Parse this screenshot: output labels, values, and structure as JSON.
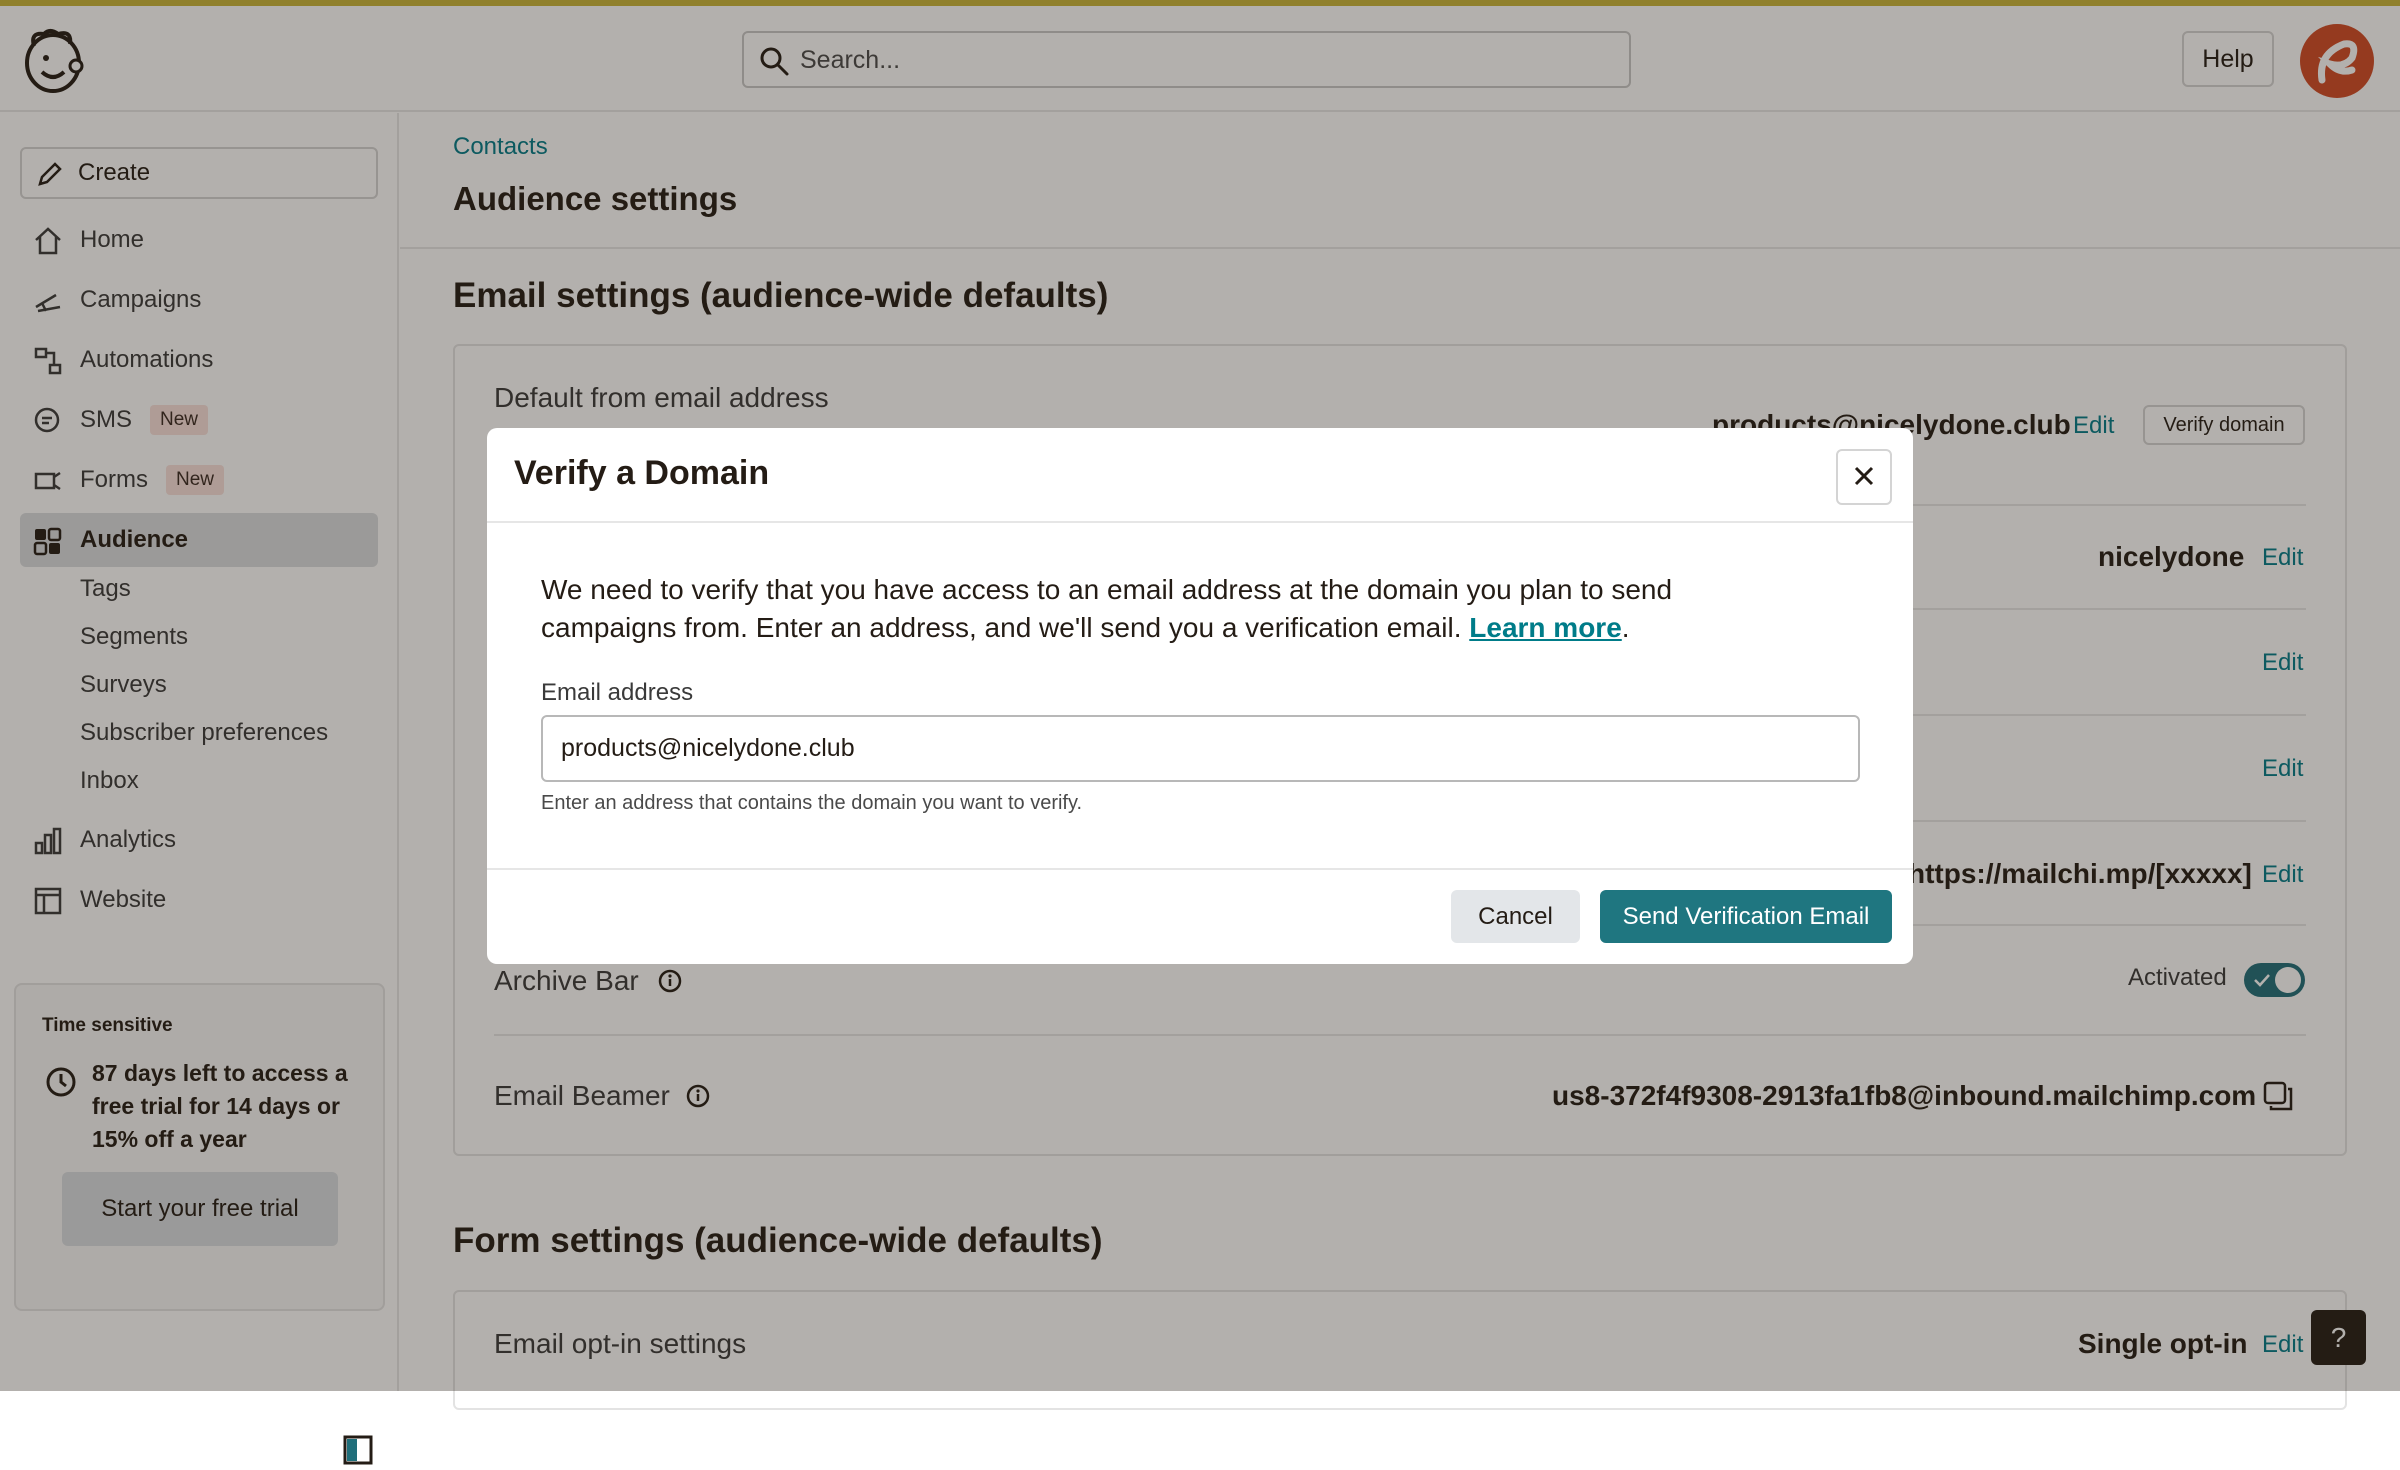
{
  "header": {
    "search_placeholder": "Search...",
    "help_label": "Help"
  },
  "sidebar": {
    "create_label": "Create",
    "items": [
      {
        "label": "Home",
        "icon": "home-icon"
      },
      {
        "label": "Campaigns",
        "icon": "megaphone-icon"
      },
      {
        "label": "Automations",
        "icon": "automations-icon"
      },
      {
        "label": "SMS",
        "icon": "sms-icon",
        "badge": "New"
      },
      {
        "label": "Forms",
        "icon": "forms-icon",
        "badge": "New"
      },
      {
        "label": "Audience",
        "icon": "audience-icon",
        "active": true
      },
      {
        "label": "Analytics",
        "icon": "bar-chart-icon"
      },
      {
        "label": "Website",
        "icon": "website-icon"
      }
    ],
    "sub_items": [
      "Tags",
      "Segments",
      "Surveys",
      "Subscriber preferences",
      "Inbox"
    ],
    "trial": {
      "tag": "Time sensitive",
      "text": "87 days left to access a free trial for 14 days or 15% off a year",
      "button": "Start your free trial"
    }
  },
  "main": {
    "breadcrumb": "Contacts",
    "title": "Audience settings",
    "email_section_title": "Email settings (audience-wide defaults)",
    "rows": {
      "from_label": "Default from email address",
      "from_value": "products@nicelydone.club",
      "verify_domain": "Verify domain",
      "name_value": "nicelydone",
      "url_value": "https://mailchi.mp/[xxxxx]",
      "archive_label": "Archive Bar",
      "archive_status": "Activated",
      "beamer_label": "Email Beamer",
      "beamer_value": "us8-372f4f9308-2913fa1fb8@inbound.mailchimp.com",
      "edit": "Edit"
    },
    "form_section_title": "Form settings (audience-wide defaults)",
    "optin_label": "Email opt-in settings",
    "optin_value": "Single opt-in"
  },
  "modal": {
    "title": "Verify a Domain",
    "description": "We need to verify that you have access to an email address at the domain you plan to send campaigns from. Enter an address, and we'll send you a verification email.",
    "learn_more": "Learn more",
    "field_label": "Email address",
    "field_value": "products@nicelydone.club",
    "field_help": "Enter an address that contains the domain you want to verify.",
    "cancel": "Cancel",
    "send": "Send Verification Email"
  },
  "colors": {
    "accent": "#007c89",
    "primary_button": "#1f7680",
    "top_stripe": "#c9b53a"
  }
}
